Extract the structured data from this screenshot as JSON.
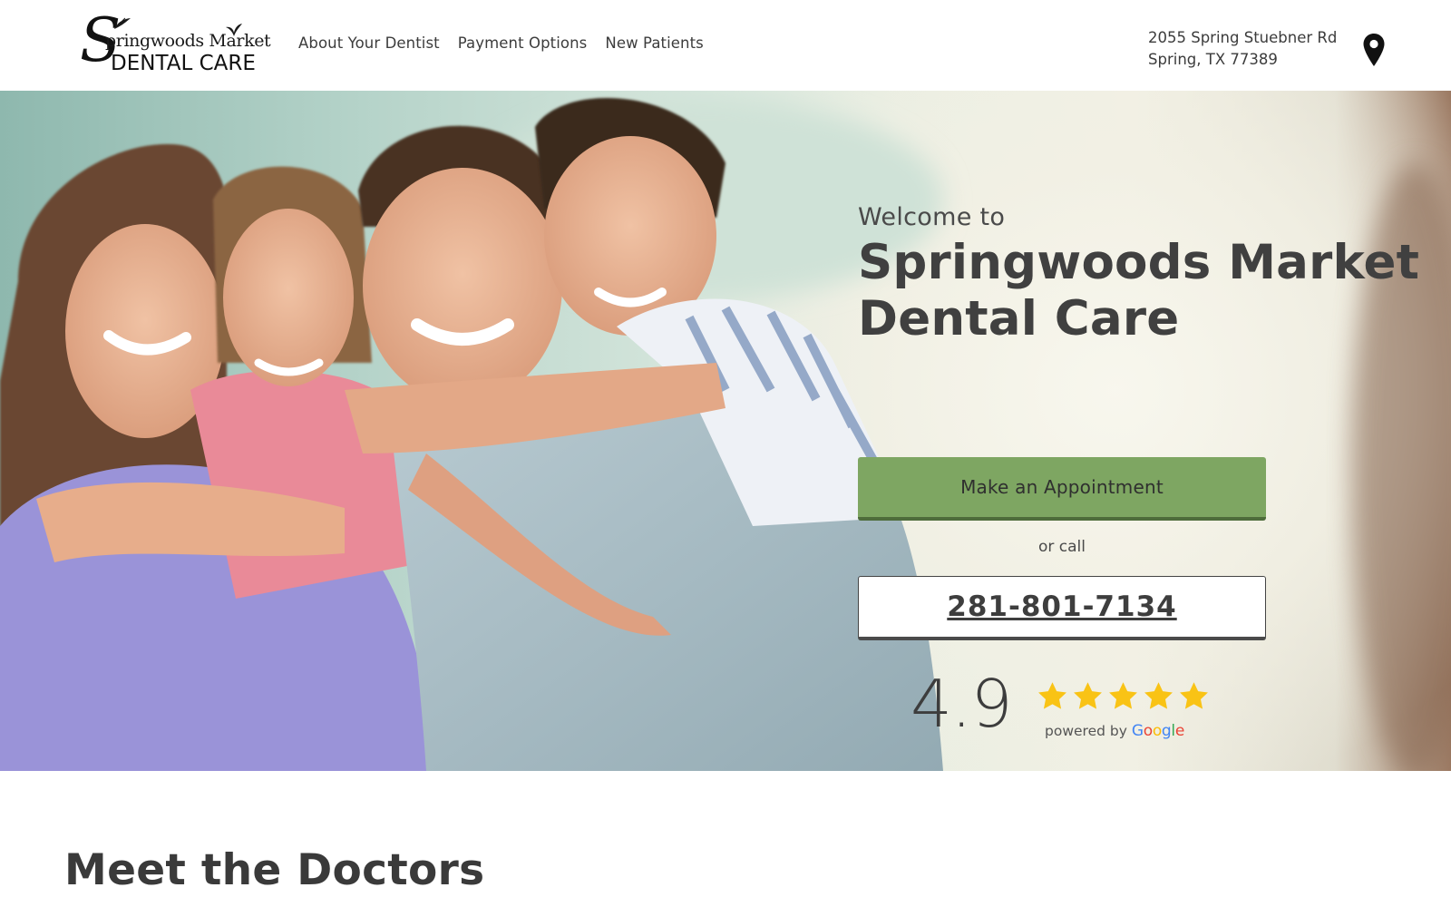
{
  "header": {
    "logo": {
      "initial": "S",
      "line1": "pringwoods Market",
      "line2": "DENTAL CARE"
    },
    "nav": [
      {
        "label": "About Your Dentist"
      },
      {
        "label": "Payment Options"
      },
      {
        "label": "New Patients"
      }
    ],
    "address": {
      "line1": "2055 Spring Stuebner Rd",
      "line2": "Spring, TX 77389"
    },
    "location_icon": "map-pin-icon"
  },
  "hero": {
    "welcome": "Welcome to",
    "title_line1": "Springwoods Market",
    "title_line2": "Dental Care",
    "appointment_label": "Make an Appointment",
    "or_call": "or call",
    "phone": "281-801-7134",
    "rating": {
      "value": "4.9",
      "stars": 5,
      "powered_by": "powered by",
      "provider": [
        "G",
        "o",
        "o",
        "g",
        "l",
        "e"
      ]
    },
    "colors": {
      "appointment_bg": "#7ea662",
      "star": "#f9c315"
    }
  },
  "section": {
    "title": "Meet the Doctors"
  }
}
